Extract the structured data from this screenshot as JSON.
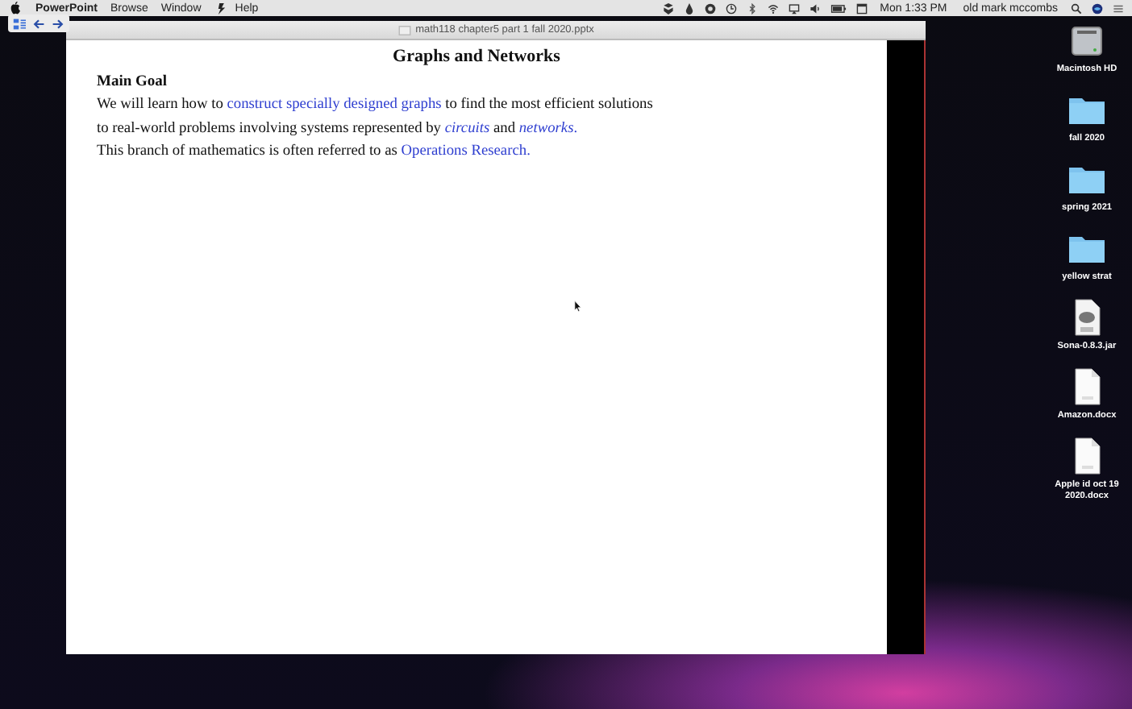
{
  "menu_bar": {
    "app_name": "PowerPoint",
    "items": [
      "Browse",
      "Window",
      "Help"
    ],
    "clock": "Mon 1:33 PM",
    "user": "old mark mccombs"
  },
  "window": {
    "title": "math118 chapter5 part 1 fall 2020.pptx"
  },
  "slide": {
    "title": "Graphs and Networks",
    "heading": "Main Goal",
    "paragraphs": [
      [
        {
          "kind": "plain",
          "text": "We will learn how to "
        },
        {
          "kind": "link",
          "text": "construct specially designed graphs"
        },
        {
          "kind": "plain",
          "text": " to find the most efficient solutions"
        }
      ],
      [
        {
          "kind": "plain",
          "text": "to real-world problems involving systems represented by "
        },
        {
          "kind": "emphasis",
          "text": "circuits"
        },
        {
          "kind": "plain",
          "text": " and "
        },
        {
          "kind": "emphasis",
          "text": "networks"
        },
        {
          "kind": "link",
          "text": "."
        }
      ],
      [
        {
          "kind": "plain",
          "text": "This branch of mathematics is often referred to as "
        },
        {
          "kind": "link",
          "text": "Operations Research."
        }
      ]
    ]
  },
  "desktop_icons": [
    {
      "kind": "drive",
      "label": "Macintosh HD"
    },
    {
      "kind": "folder",
      "label": "fall 2020"
    },
    {
      "kind": "folder",
      "label": "spring 2021"
    },
    {
      "kind": "folder",
      "label": "yellow strat"
    },
    {
      "kind": "jar",
      "label": "Sona-0.8.3.jar"
    },
    {
      "kind": "doc",
      "label": "Amazon.docx"
    },
    {
      "kind": "doc",
      "label": "Apple id oct 19 2020.docx"
    }
  ]
}
